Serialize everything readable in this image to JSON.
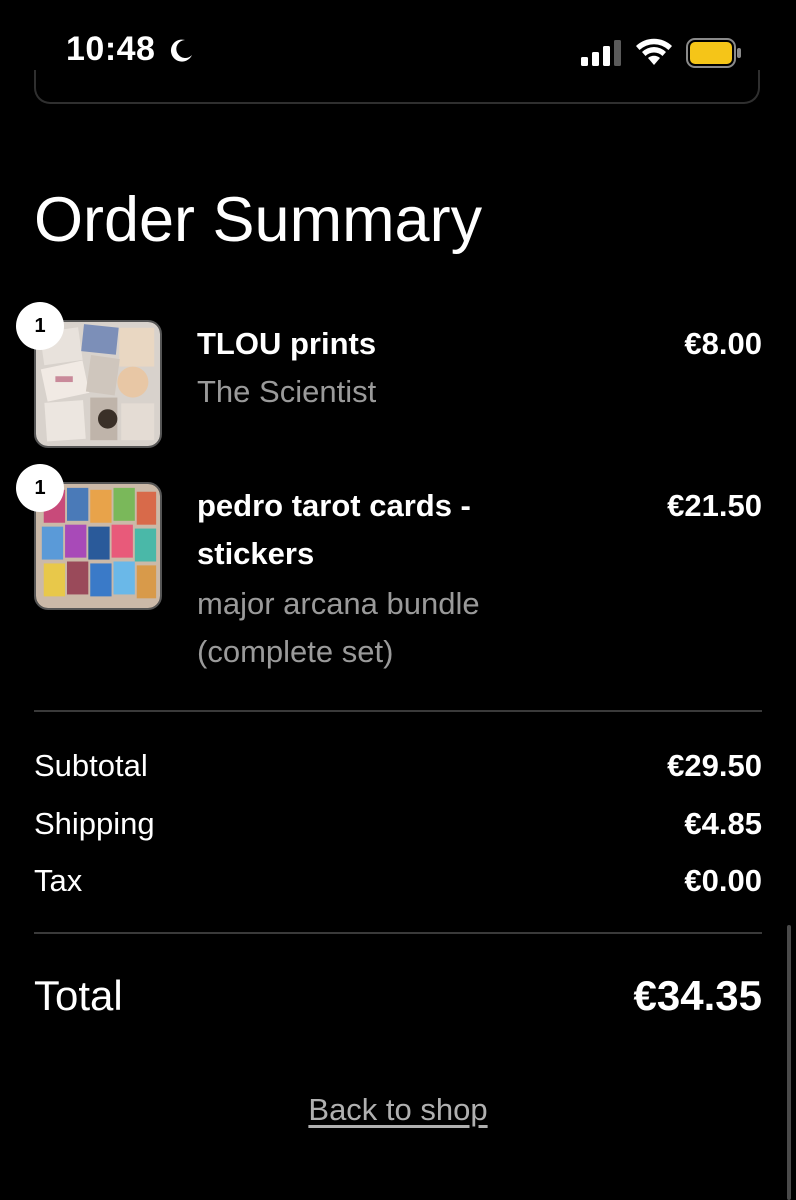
{
  "status_bar": {
    "time": "10:48",
    "moon_icon": "moon-icon",
    "signal_icon": "cellular-signal-icon",
    "wifi_icon": "wifi-icon",
    "battery_icon": "battery-icon",
    "battery_color": "#f5c518"
  },
  "page": {
    "title": "Order Summary"
  },
  "items": [
    {
      "quantity": "1",
      "name": "TLOU prints",
      "variant": "The Scientist",
      "price": "€8.00"
    },
    {
      "quantity": "1",
      "name": "pedro tarot cards - stickers",
      "variant": "major arcana bundle (complete set)",
      "price": "€21.50"
    }
  ],
  "summary": {
    "subtotal_label": "Subtotal",
    "subtotal_value": "€29.50",
    "shipping_label": "Shipping",
    "shipping_value": "€4.85",
    "tax_label": "Tax",
    "tax_value": "€0.00",
    "total_label": "Total",
    "total_value": "€34.35"
  },
  "footer": {
    "back_link": "Back to shop"
  },
  "colors": {
    "background": "#000000",
    "text": "#ffffff",
    "muted_text": "#9a9a9a",
    "divider": "#3a3a3a"
  }
}
